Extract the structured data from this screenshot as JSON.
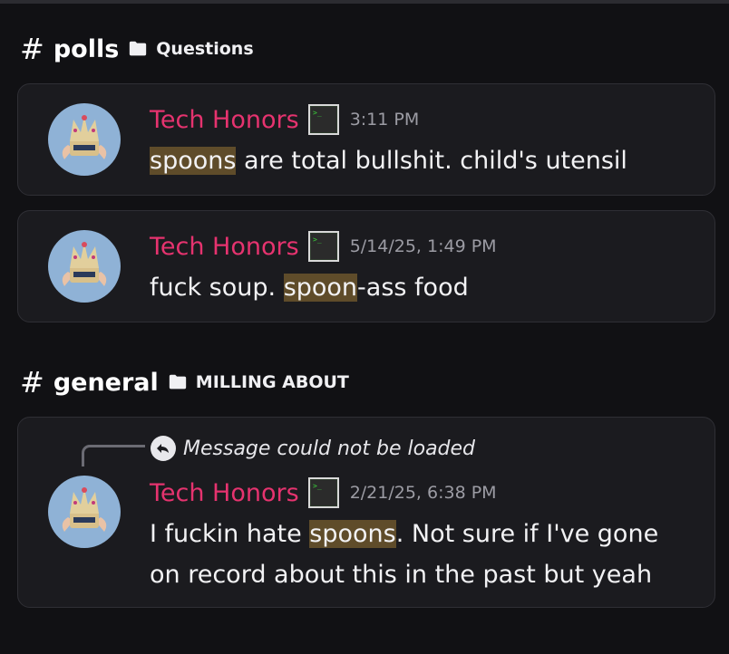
{
  "sections": [
    {
      "hash": "#",
      "channel": "polls",
      "category": "Questions",
      "messages": [
        {
          "author": "Tech Honors",
          "time": "3:11 PM",
          "parts": [
            {
              "text": "spoons",
              "hl": true
            },
            {
              "text": " are total bullshit. child's utensil",
              "hl": false
            }
          ]
        },
        {
          "author": "Tech Honors",
          "time": "5/14/25, 1:49 PM",
          "parts": [
            {
              "text": "fuck soup. ",
              "hl": false
            },
            {
              "text": "spoon",
              "hl": true
            },
            {
              "text": "-ass food",
              "hl": false
            }
          ]
        }
      ]
    },
    {
      "hash": "#",
      "channel": "general",
      "category": "MILLING ABOUT",
      "messages": [
        {
          "reply": "Message could not be loaded",
          "author": "Tech Honors",
          "time": "2/21/25, 6:38 PM",
          "line1_parts": [
            {
              "text": "I fuckin hate ",
              "hl": false
            },
            {
              "text": "spoons",
              "hl": true
            },
            {
              "text": ". Not sure if I've gone",
              "hl": false
            }
          ],
          "line2": "on record about this in the past but yeah"
        }
      ]
    }
  ],
  "icons": {
    "folder": "folder-icon",
    "app": "terminal-app-icon",
    "reply": "reply-arrow-icon",
    "avatar": "crown-avatar"
  },
  "colors": {
    "author": "#e6336f",
    "highlight": "#5f4c2a",
    "background": "#111114",
    "card": "#1b1b1f"
  }
}
